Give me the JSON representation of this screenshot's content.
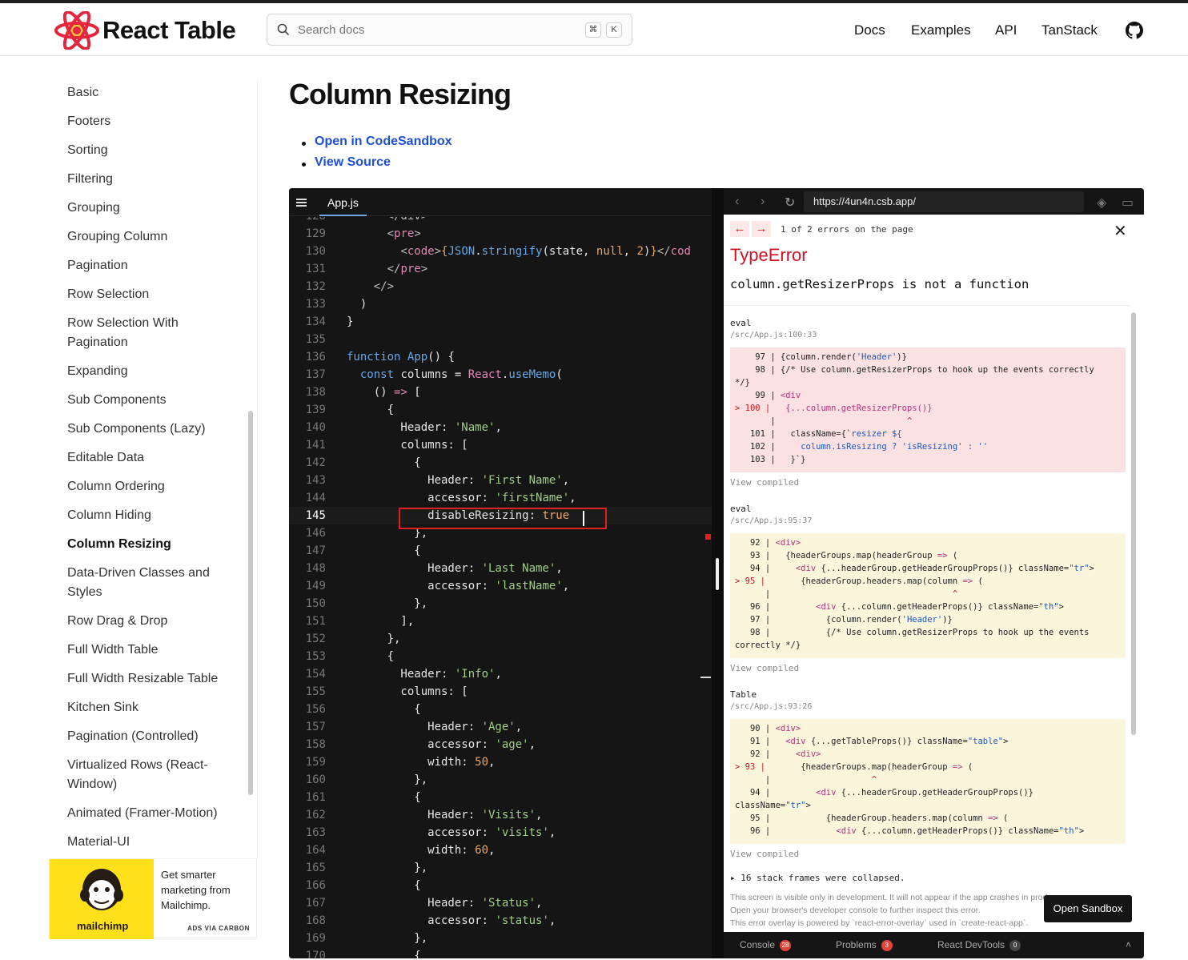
{
  "header": {
    "logo_text": "React Table",
    "search_placeholder": "Search docs",
    "kbd_cmd": "⌘",
    "kbd_k": "K",
    "nav": [
      "Docs",
      "Examples",
      "API",
      "TanStack"
    ]
  },
  "sidebar": {
    "items": [
      "Basic",
      "Footers",
      "Sorting",
      "Filtering",
      "Grouping",
      "Grouping Column",
      "Pagination",
      "Row Selection",
      "Row Selection With Pagination",
      "Expanding",
      "Sub Components",
      "Sub Components (Lazy)",
      "Editable Data",
      "Column Ordering",
      "Column Hiding",
      "Column Resizing",
      "Data-Driven Classes and Styles",
      "Row Drag & Drop",
      "Full Width Table",
      "Full Width Resizable Table",
      "Kitchen Sink",
      "Pagination (Controlled)",
      "Virtualized Rows (React-Window)",
      "Animated (Framer-Motion)",
      "Material-UI"
    ],
    "active": "Column Resizing"
  },
  "ad": {
    "brand": "mailchimp",
    "text": "Get smarter marketing from Mailchimp.",
    "via": "ADS VIA CARBON"
  },
  "main": {
    "title": "Column Resizing",
    "links": [
      "Open in CodeSandbox",
      "View Source"
    ]
  },
  "editor": {
    "file_tab": "App.js",
    "current_line": "145"
  },
  "preview": {
    "url": "https://4un4n.csb.app/",
    "error_nav_prev": "←",
    "error_nav_next": "→",
    "error_count": "1 of 2 errors on the page",
    "error_type": "TypeError",
    "error_message": "column.getResizerProps is not a function",
    "frames": [
      {
        "name": "eval",
        "file": "/src/App.js:100:33"
      },
      {
        "name": "eval",
        "file": "/src/App.js:95:37"
      },
      {
        "name": "Table",
        "file": "/src/App.js:93:26"
      }
    ],
    "view_compiled": "View compiled",
    "collapsed_note": "▸ 16 stack frames were collapsed.",
    "footer_lines": [
      "This screen is visible only in development. It will not appear if the app crashes in production.",
      "Open your browser's developer console to further inspect this error.",
      "This error overlay is powered by `react-error-overlay` used in `create-react-app`."
    ],
    "open_sandbox": "Open Sandbox",
    "status": {
      "console": "Console",
      "console_count": "28",
      "problems": "Problems",
      "problems_count": "3",
      "devtools": "React DevTools",
      "devtools_count": "0"
    }
  },
  "colors": {
    "link": "#1d4ed8",
    "error": "#cf1322",
    "editor_bg": "#151515",
    "highlight_box": "#e0201e"
  }
}
